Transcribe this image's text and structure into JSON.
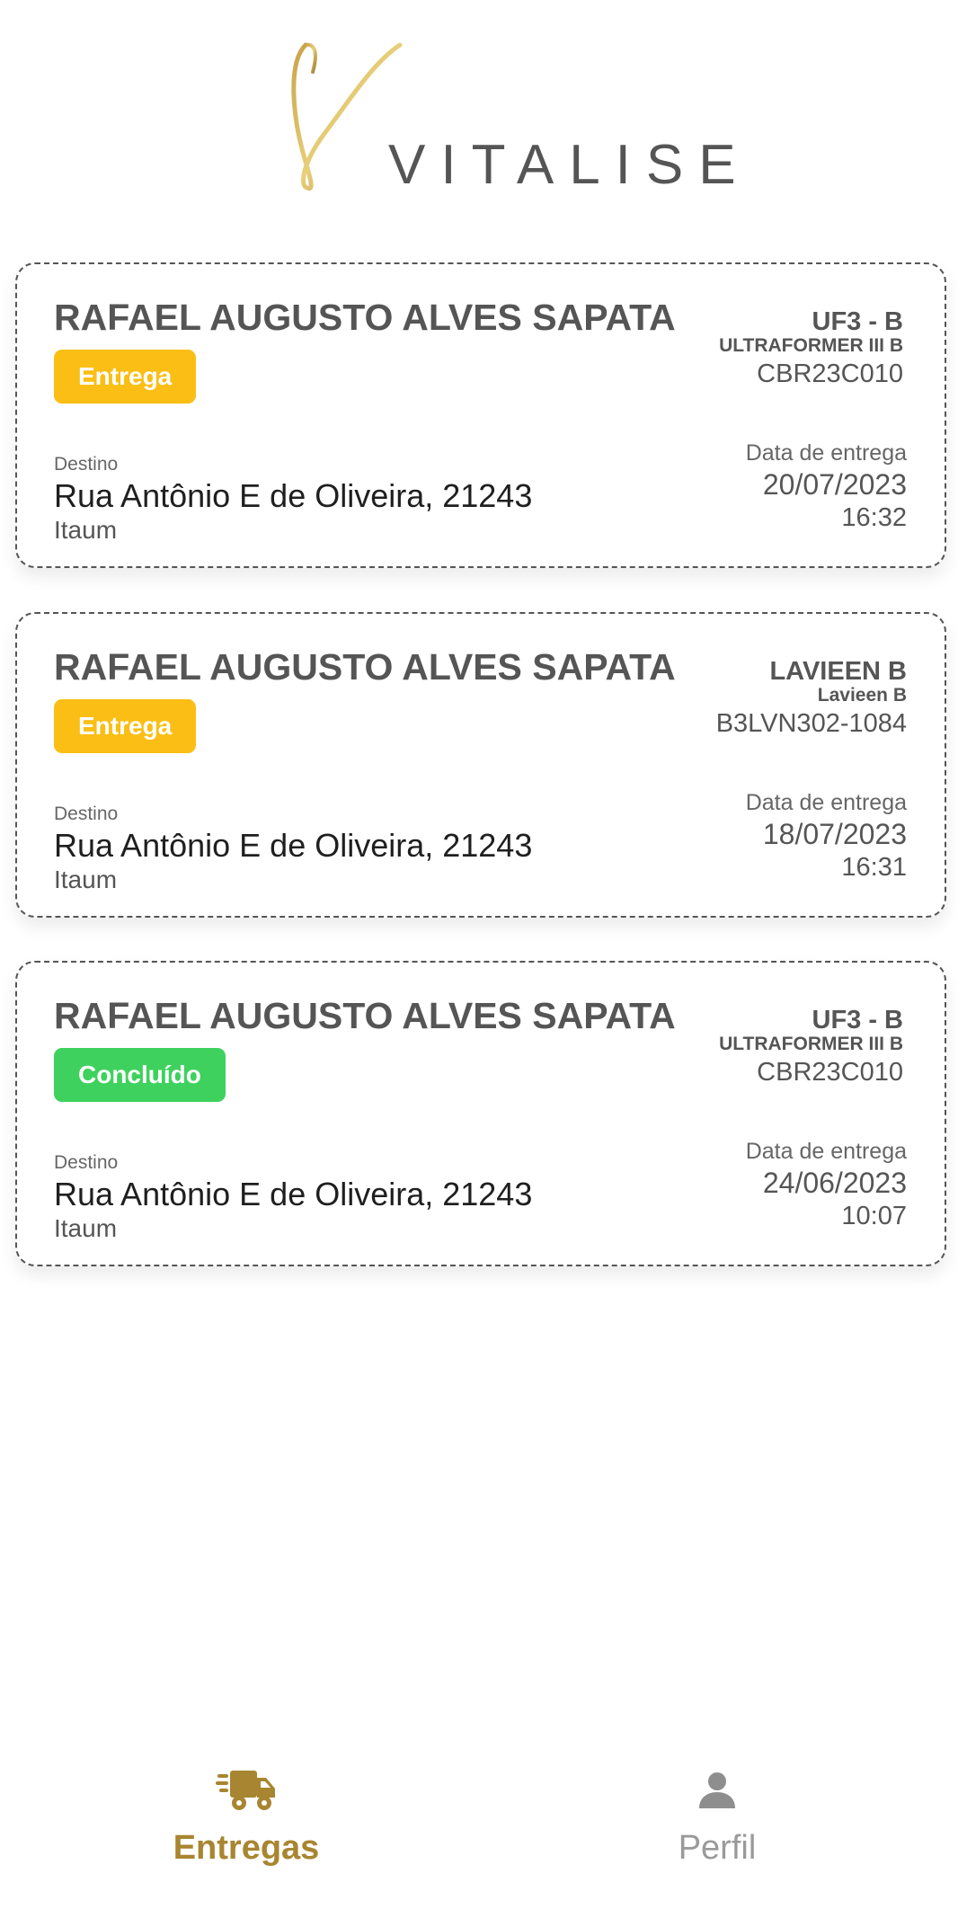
{
  "app": {
    "logo_text": "VITALISE"
  },
  "deliveries": [
    {
      "name": "RAFAEL AUGUSTO ALVES SAPATA",
      "status": "Entrega",
      "status_color": "#fbbe14",
      "equipment_code": "UF3 - B",
      "equipment_model": "ULTRAFORMER III B",
      "serial": "CBR23C010",
      "destination_label": "Destino",
      "address": "Rua Antônio E de Oliveira, 21243",
      "city": "Itaum",
      "date_label": "Data de entrega",
      "date": "20/07/2023",
      "time": "16:32"
    },
    {
      "name": "RAFAEL AUGUSTO ALVES SAPATA",
      "status": "Entrega",
      "status_color": "#fbbe14",
      "equipment_code": "LAVIEEN B",
      "equipment_model": "Lavieen B",
      "serial": "B3LVN302-1084",
      "destination_label": "Destino",
      "address": "Rua Antônio E de Oliveira, 21243",
      "city": "Itaum",
      "date_label": "Data de entrega",
      "date": "18/07/2023",
      "time": "16:31"
    },
    {
      "name": "RAFAEL AUGUSTO ALVES SAPATA",
      "status": "Concluído",
      "status_color": "#3ed15e",
      "equipment_code": "UF3 - B",
      "equipment_model": "ULTRAFORMER III B",
      "serial": "CBR23C010",
      "destination_label": "Destino",
      "address": "Rua Antônio E de Oliveira, 21243",
      "city": "Itaum",
      "date_label": "Data de entrega",
      "date": "24/06/2023",
      "time": "10:07"
    }
  ],
  "nav": {
    "items": [
      {
        "label": "Entregas",
        "icon": "truck-icon",
        "active": true
      },
      {
        "label": "Perfil",
        "icon": "user-icon",
        "active": false
      }
    ],
    "active_color": "#a88530",
    "inactive_color": "#9a9a9a"
  }
}
